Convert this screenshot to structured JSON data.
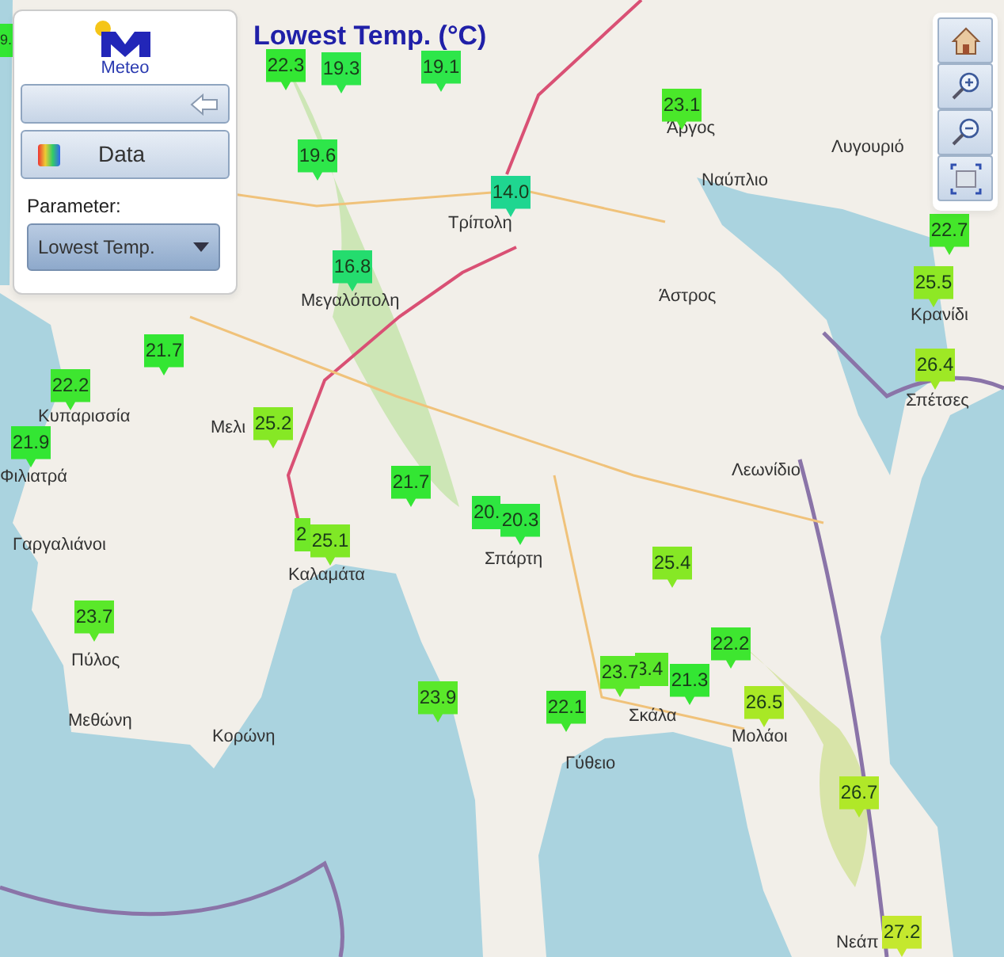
{
  "sidebar": {
    "logo_text": "Meteo",
    "data_button": "Data",
    "parameter_label": "Parameter:",
    "parameter_select": {
      "value": "Lowest Temp."
    }
  },
  "map": {
    "title": "Lowest Temp. (°C)",
    "places": [
      {
        "name": "Άργος"
      },
      {
        "name": "Ναύπλιο"
      },
      {
        "name": "Λυγουριό"
      },
      {
        "name": "Τρίπολη"
      },
      {
        "name": "Μεγαλόπολη"
      },
      {
        "name": "Άστρος"
      },
      {
        "name": "Κρανίδι"
      },
      {
        "name": "Σπέτσες"
      },
      {
        "name": "Κυπαρισσία"
      },
      {
        "name": "Μελι"
      },
      {
        "name": "Φιλιατρά"
      },
      {
        "name": "Γαργαλιάνοι"
      },
      {
        "name": "Καλαμάτα"
      },
      {
        "name": "Σπάρτη"
      },
      {
        "name": "Λεωνίδιο"
      },
      {
        "name": "Πύλος"
      },
      {
        "name": "Μεθώνη"
      },
      {
        "name": "Κορώνη"
      },
      {
        "name": "Σκάλα"
      },
      {
        "name": "Μολάοι"
      },
      {
        "name": "Γύθειο"
      },
      {
        "name": "Νεάπ"
      }
    ],
    "stations": [
      {
        "value": "9.",
        "color": "#33e633"
      },
      {
        "value": "22.3",
        "color": "#33e633"
      },
      {
        "value": "19.3",
        "color": "#2ee64a"
      },
      {
        "value": "19.1",
        "color": "#2ee64a"
      },
      {
        "value": "19.6",
        "color": "#2ee64a"
      },
      {
        "value": "14.0",
        "color": "#1fd690"
      },
      {
        "value": "16.8",
        "color": "#24dc6e"
      },
      {
        "value": "23.1",
        "color": "#4ae82a"
      },
      {
        "value": "22.7",
        "color": "#44e62a"
      },
      {
        "value": "25.5",
        "color": "#8ee825"
      },
      {
        "value": "26.4",
        "color": "#9ee825"
      },
      {
        "value": "21.7",
        "color": "#33e633"
      },
      {
        "value": "22.2",
        "color": "#3ee630"
      },
      {
        "value": "21.9",
        "color": "#33e633"
      },
      {
        "value": "25.2",
        "color": "#86e825"
      },
      {
        "value": "21.7",
        "color": "#33e633"
      },
      {
        "value": "2",
        "color": "#70e828"
      },
      {
        "value": "25.1",
        "color": "#80e826"
      },
      {
        "value": "20.",
        "color": "#2ee640"
      },
      {
        "value": "20.3",
        "color": "#2ee640"
      },
      {
        "value": "23.7",
        "color": "#5ae82a"
      },
      {
        "value": "25.4",
        "color": "#86e825"
      },
      {
        "value": "3.4",
        "color": "#5ae82a"
      },
      {
        "value": "23.7",
        "color": "#5ae82a"
      },
      {
        "value": "21.3",
        "color": "#33e633"
      },
      {
        "value": "22.2",
        "color": "#3ee630"
      },
      {
        "value": "23.9",
        "color": "#5ae82a"
      },
      {
        "value": "22.1",
        "color": "#3ee630"
      },
      {
        "value": "26.5",
        "color": "#a8e825"
      },
      {
        "value": "26.7",
        "color": "#b0e828"
      },
      {
        "value": "27.2",
        "color": "#c4e82e"
      }
    ]
  }
}
